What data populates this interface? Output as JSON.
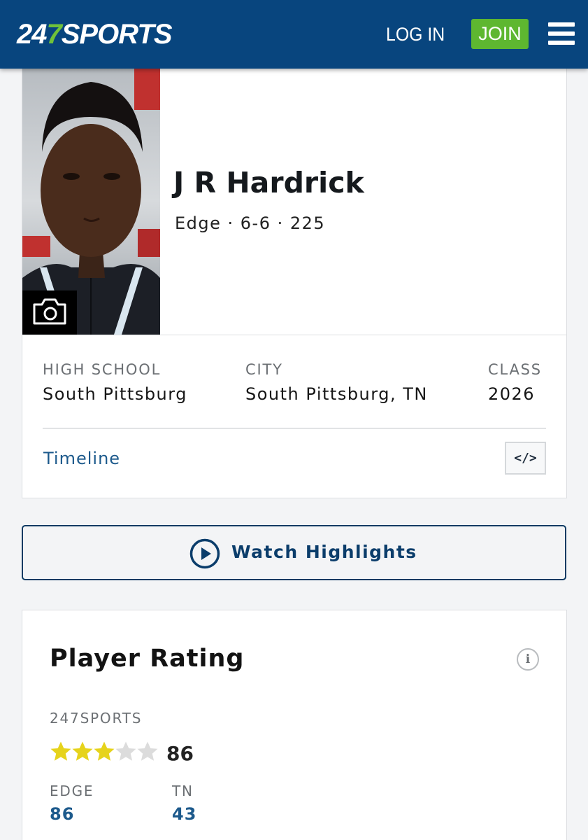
{
  "header": {
    "logo_prefix": "247",
    "logo_mid": "SPORTS",
    "login_label": "LOG IN",
    "join_label": "JOIN",
    "menu_icon": "hamburger-menu-icon",
    "colors": {
      "bar": "#08457e",
      "join": "#5eb730",
      "logo_accent": "#6fc23a"
    }
  },
  "player": {
    "name": "J R Hardrick",
    "meta": "Edge · 6-6 · 225",
    "photo_icon": "camera-icon",
    "high_school_label": "HIGH SCHOOL",
    "high_school": "South Pittsburg",
    "city_label": "CITY",
    "city": "South Pittsburg, TN",
    "class_label": "CLASS",
    "class": "2026",
    "timeline_label": "Timeline",
    "embed_label": "</>",
    "embed_icon": "embed-code-icon"
  },
  "highlights": {
    "label": "Watch Highlights",
    "icon": "play-circle-icon"
  },
  "rating": {
    "title": "Player Rating",
    "info_icon": "info-icon",
    "source": "247SPORTS",
    "stars_filled": 3,
    "stars_total": 5,
    "score": "86",
    "position_label": "EDGE",
    "position_rank": "86",
    "state_label": "TN",
    "state_rank": "43",
    "colors": {
      "star_on": "#e6d31c",
      "star_off": "#dcdcdc",
      "link": "#1d5a8c"
    }
  }
}
